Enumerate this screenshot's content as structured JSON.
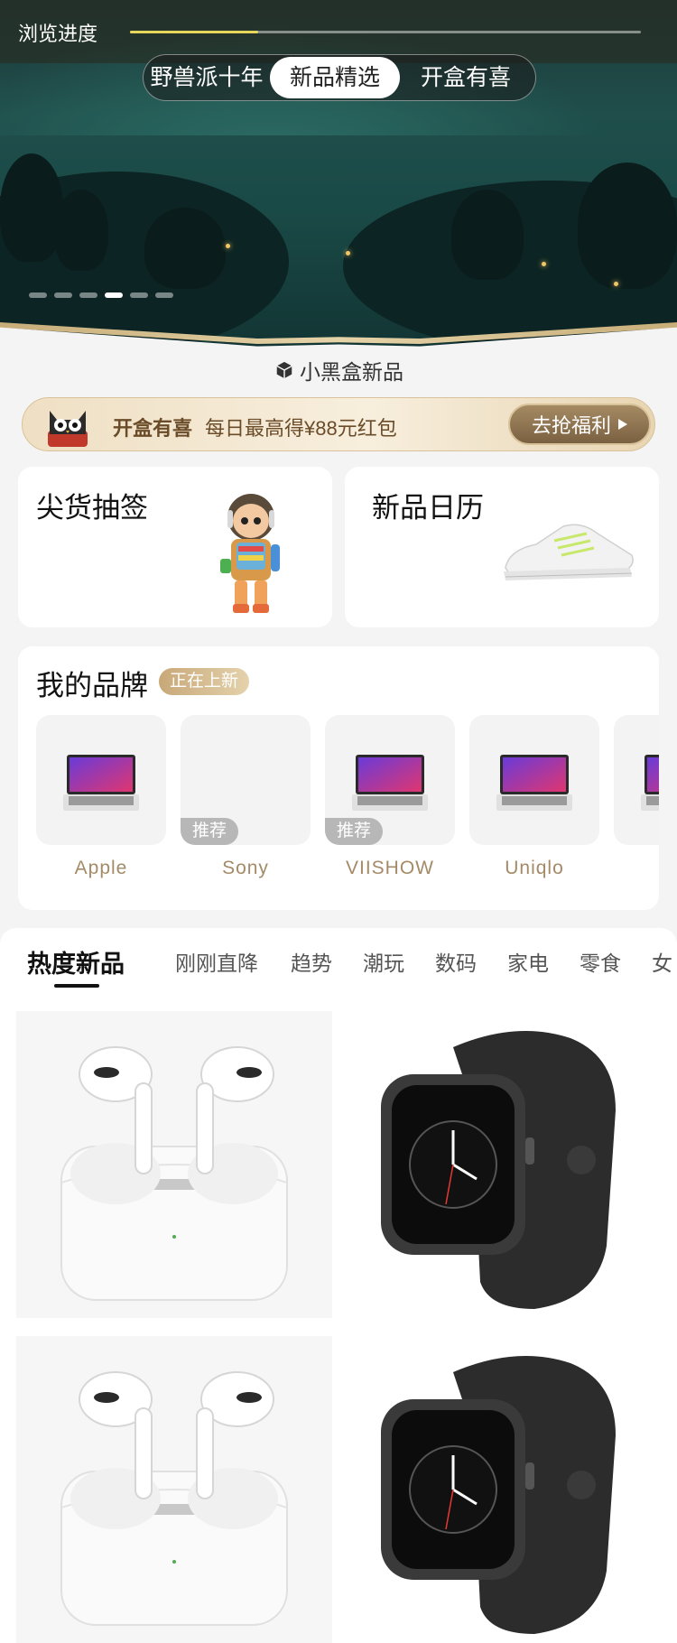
{
  "header": {
    "progress_label": "浏览进度",
    "progress_percent": 25
  },
  "segments": [
    "野兽派十年",
    "新品精选",
    "开盒有喜"
  ],
  "selected_segment": "新品精选",
  "carousel": {
    "count": 6,
    "active_index": 3
  },
  "section_tab": {
    "label": "小黑盒新品",
    "icon": "cube-icon"
  },
  "promo": {
    "icon": "cat-icon",
    "title": "开盒有喜",
    "text": "每日最高得¥88元红包",
    "button": "去抢福利"
  },
  "cards": [
    {
      "title": "尖货抽签",
      "image": "toy-figure"
    },
    {
      "title": "新品日历",
      "image": "sneaker"
    }
  ],
  "my_brands": {
    "title": "我的品牌",
    "badge": "正在上新",
    "items": [
      {
        "name": "Apple",
        "tag": ""
      },
      {
        "name": "Sony",
        "tag": "推荐"
      },
      {
        "name": "VIISHOW",
        "tag": "推荐"
      },
      {
        "name": "Uniqlo",
        "tag": ""
      }
    ]
  },
  "category_tabs": [
    "热度新品",
    "刚刚直降",
    "趋势",
    "潮玩",
    "数码",
    "家电",
    "零食",
    "女"
  ],
  "active_category": "热度新品",
  "colors": {
    "accent_gold": "#c8a878",
    "promo_text": "#6b4c29",
    "brand_name": "#a48a66"
  }
}
